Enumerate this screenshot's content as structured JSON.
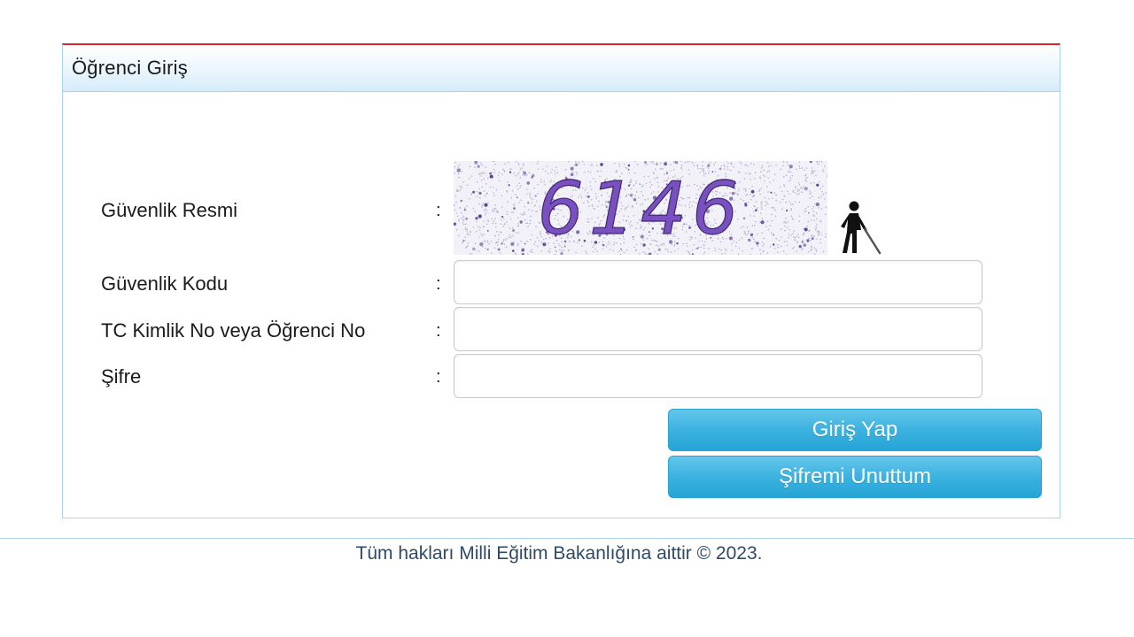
{
  "panel": {
    "title": "Öğrenci Giriş"
  },
  "form": {
    "captcha_label": "Güvenlik Resmi",
    "captcha_text": "6146",
    "security_code_label": "Güvenlik Kodu",
    "security_code_value": "",
    "tc_label": "TC Kimlik No veya Öğrenci No",
    "tc_value": "",
    "password_label": "Şifre",
    "password_value": "",
    "colon": ":"
  },
  "buttons": {
    "login_label": "Giriş Yap",
    "forgot_label": "Şifremi Unuttum"
  },
  "footer": {
    "text": "Tüm hakları Milli Eğitim Bakanlığına aittir © 2023."
  },
  "icons": {
    "accessibility": "blind-person-with-cane-icon"
  },
  "colors": {
    "accent_red": "#d9232e",
    "border_blue": "#a8d4ee",
    "button_blue": "#3cb2e0",
    "captcha_text": "#7a4fbf",
    "footer_text": "#2e4a66"
  }
}
